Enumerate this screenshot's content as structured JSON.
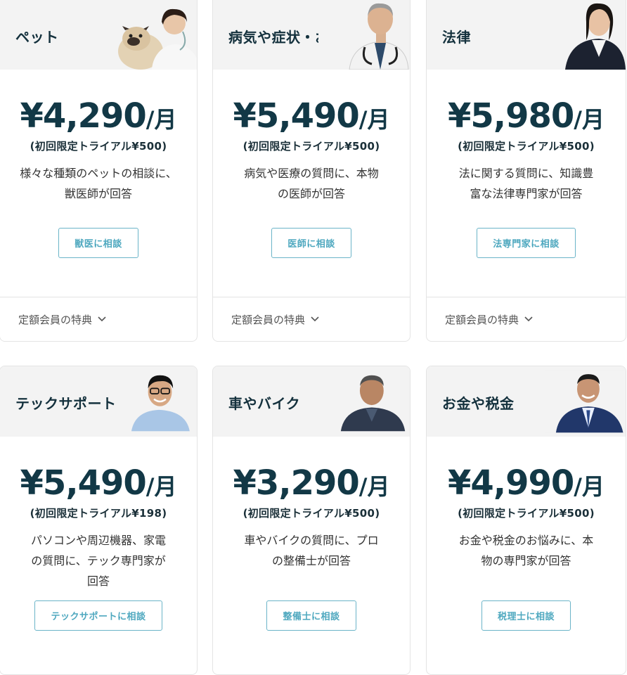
{
  "cards": [
    {
      "title": "ペット",
      "price": "¥4,290",
      "unit": "/月",
      "trial": "(初回限定トライアル¥500)",
      "desc_lines": [
        "様々な種類のペットの相談に、",
        "獣医師が回答"
      ],
      "cta": "獣医に相談",
      "benefits": "定額会員の特典",
      "portrait_icon": "veterinarian-with-pug-photo"
    },
    {
      "title": "病気や症状・お薬",
      "price": "¥5,490",
      "unit": "/月",
      "trial": "(初回限定トライアル¥500)",
      "desc_lines": [
        "病気や医療の質問に、本物",
        "の医師が回答"
      ],
      "cta": "医師に相談",
      "benefits": "定額会員の特典",
      "portrait_icon": "doctor-photo"
    },
    {
      "title": "法律",
      "price": "¥5,980",
      "unit": "/月",
      "trial": "(初回限定トライアル¥500)",
      "desc_lines": [
        "法に関する質問に、知識豊",
        "富な法律専門家が回答"
      ],
      "cta": "法専門家に相談",
      "benefits": "定額会員の特典",
      "portrait_icon": "lawyer-photo"
    },
    {
      "title": "テックサポート",
      "price": "¥5,490",
      "unit": "/月",
      "trial": "(初回限定トライアル¥198)",
      "desc_lines": [
        "パソコンや周辺機器、家電",
        "の質問に、テック専門家が",
        "回答"
      ],
      "cta": "テックサポートに相談",
      "benefits": "",
      "portrait_icon": "tech-support-photo"
    },
    {
      "title": "車やバイク",
      "price": "¥3,290",
      "unit": "/月",
      "trial": "(初回限定トライアル¥500)",
      "desc_lines": [
        "車やバイクの質問に、プロ",
        "の整備士が回答"
      ],
      "cta": "整備士に相談",
      "benefits": "",
      "portrait_icon": "mechanic-photo"
    },
    {
      "title": "お金や税金",
      "price": "¥4,990",
      "unit": "/月",
      "trial": "(初回限定トライアル¥500)",
      "desc_lines": [
        "お金や税金のお悩みに、本",
        "物の専門家が回答"
      ],
      "cta": "税理士に相談",
      "benefits": "",
      "portrait_icon": "tax-accountant-photo"
    }
  ],
  "colors": {
    "accent": "#4ea8bf",
    "price": "#123846",
    "header_bg": "#f3f3f3"
  }
}
